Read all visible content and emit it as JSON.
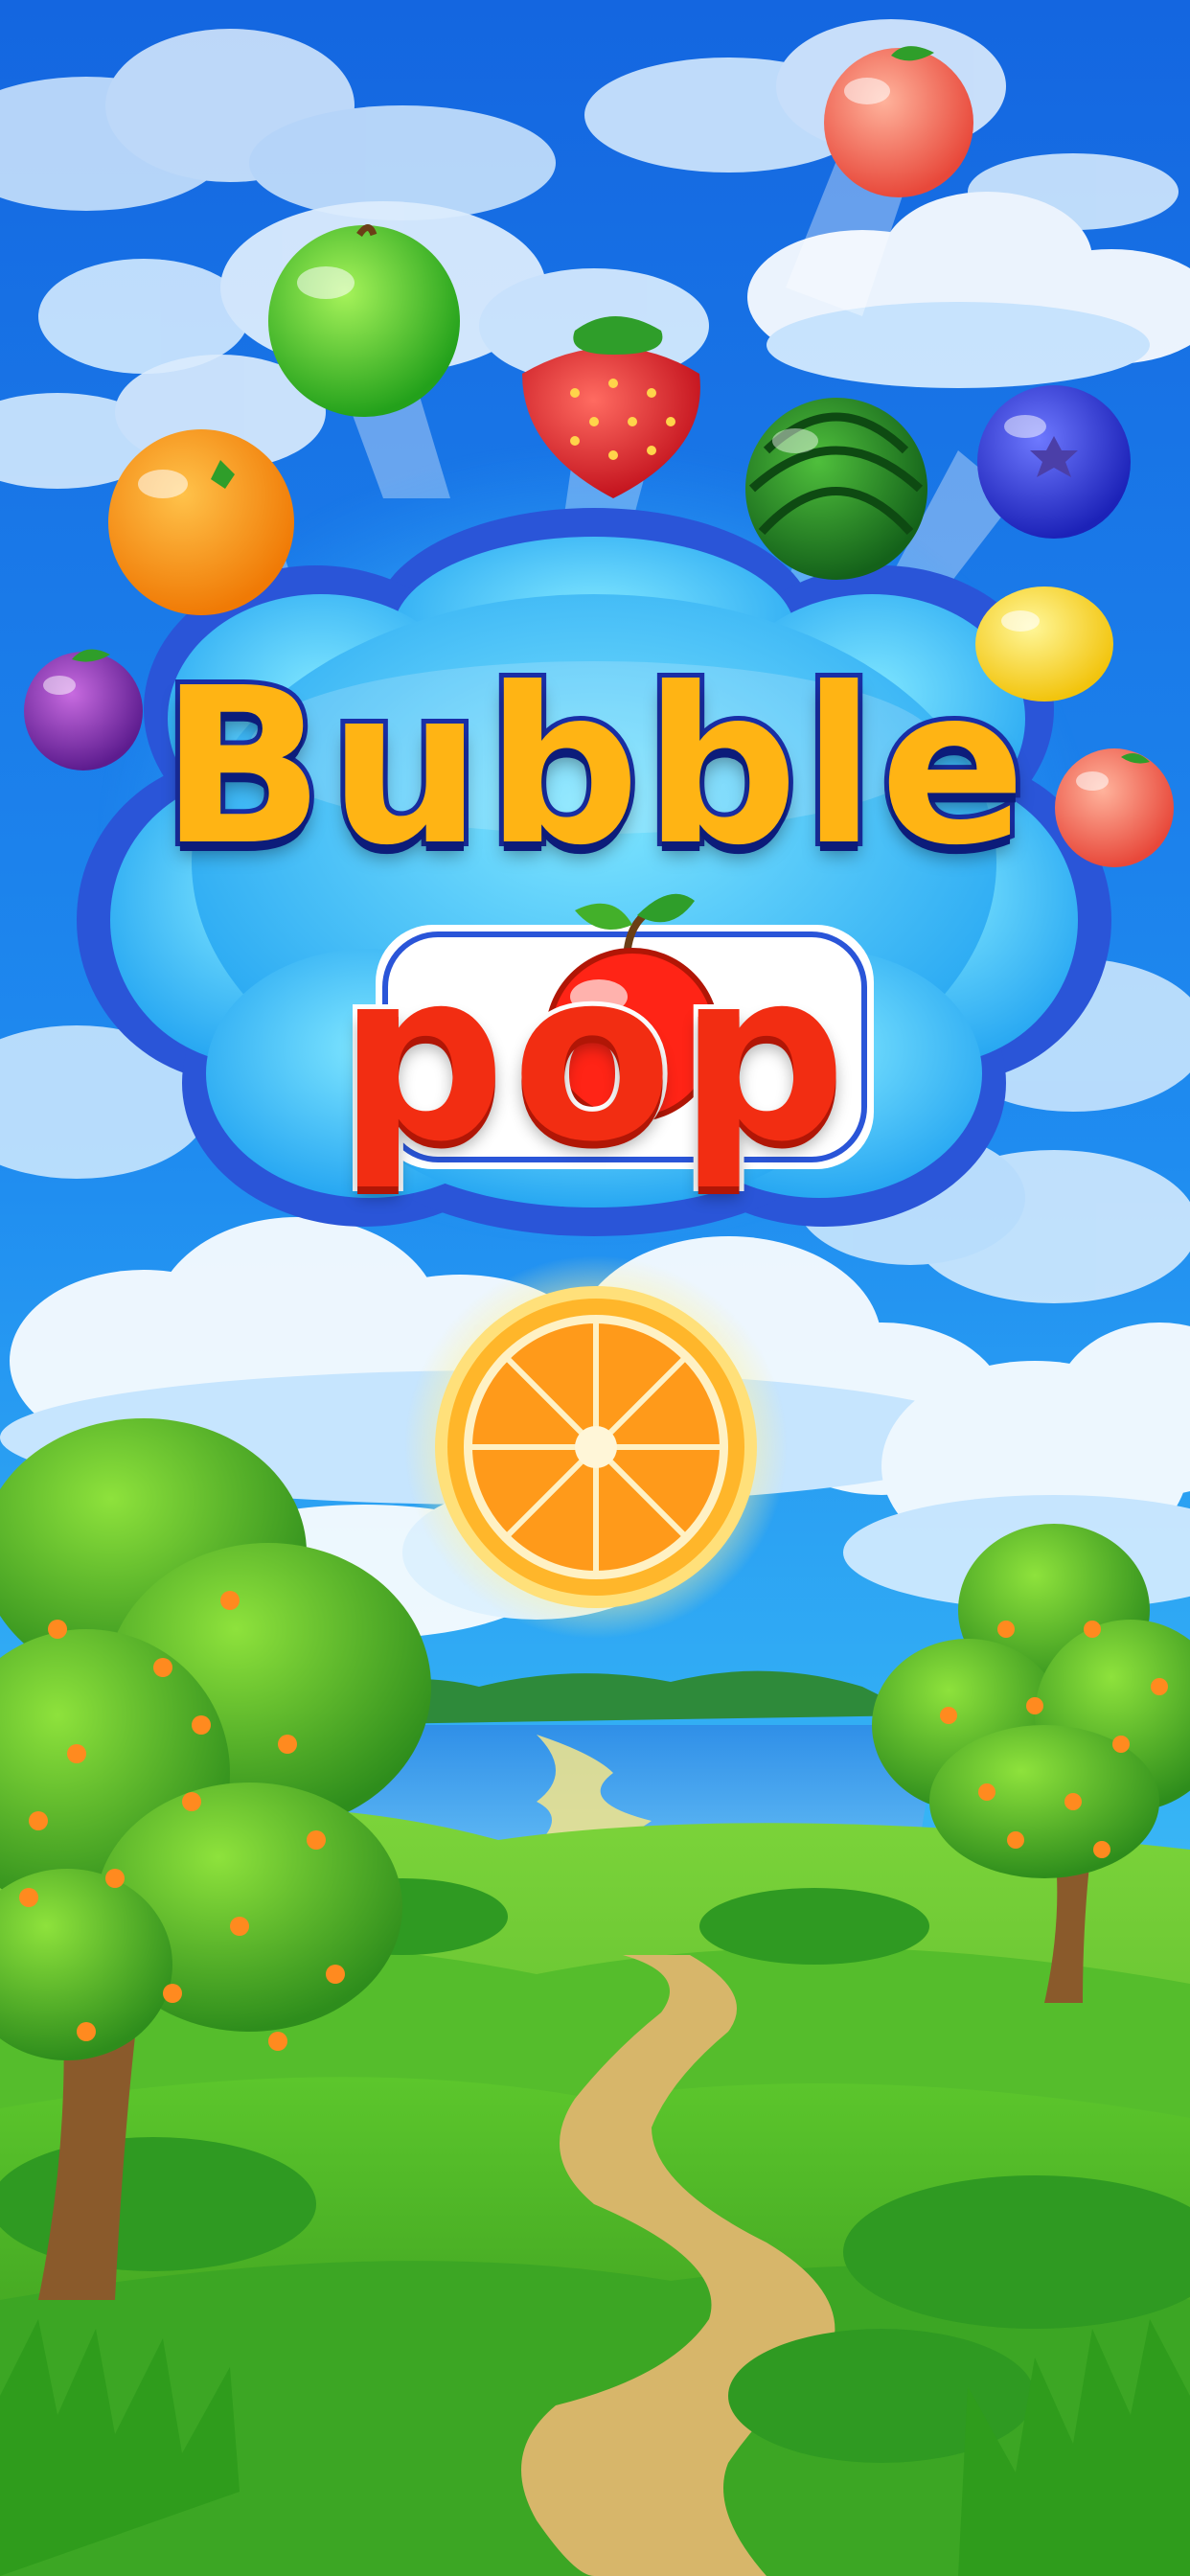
{
  "logo": {
    "line1": "Bubble",
    "line2": "pop"
  },
  "colors": {
    "sky_top": "#1466e0",
    "sky_bottom": "#35b3f5",
    "logo_yellow": "#ffb414",
    "logo_outline": "#1a2fa8",
    "logo_red": "#f22d12",
    "grass": "#44b52a"
  },
  "fruit_bubbles": [
    {
      "name": "peach-bubble-icon"
    },
    {
      "name": "green-apple-bubble-icon"
    },
    {
      "name": "strawberry-bubble-icon"
    },
    {
      "name": "orange-bubble-icon"
    },
    {
      "name": "watermelon-bubble-icon"
    },
    {
      "name": "blueberry-bubble-icon"
    },
    {
      "name": "lemon-bubble-icon"
    },
    {
      "name": "plum-bubble-icon"
    },
    {
      "name": "peach-small-bubble-icon"
    }
  ],
  "center_bubble": {
    "name": "orange-slice-bubble-icon"
  }
}
